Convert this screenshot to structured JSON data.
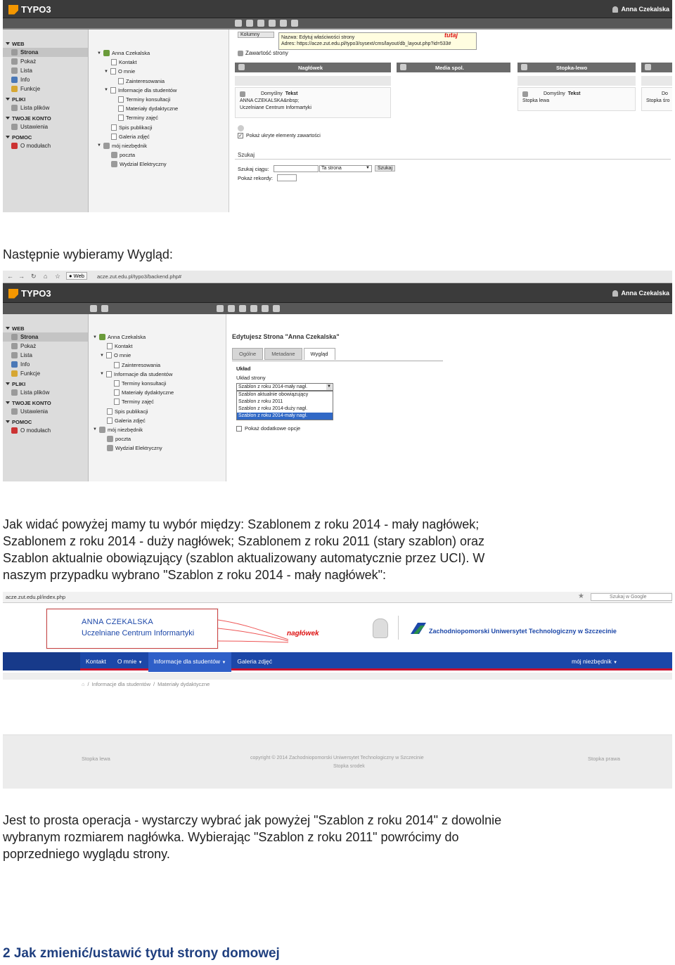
{
  "shot1": {
    "logo": "TYPO3",
    "user": "Anna Czekalska",
    "module_menu": [
      {
        "group": "WEB",
        "items": [
          "Strona",
          "Pokaż",
          "Lista",
          "Info",
          "Funkcje"
        ],
        "active": "Strona"
      },
      {
        "group": "PLIKI",
        "items": [
          "Lista plików"
        ]
      },
      {
        "group": "TWOJE KONTO",
        "items": [
          "Ustawienia"
        ]
      },
      {
        "group": "POMOC",
        "items": [
          "O modułach"
        ]
      }
    ],
    "tree": [
      "Anna Czekalska",
      "Kontakt",
      "O mnie",
      "Zainteresowania",
      "Informacje dla studentów",
      "Terminy konsultacji",
      "Materiały dydaktyczne",
      "Terminy zajęć",
      "Spis publikacji",
      "Galeria zdjęć",
      "mój niezbędnik",
      "poczta",
      "Wydział Elektryczny"
    ],
    "column_select": "Kolumny",
    "tooltip_line1": "Nazwa: Edytuj właściwości strony",
    "tooltip_line2": "Adres: https://acze.zut.edu.pl/typo3/sysext/cms/layout/db_layout.php?id=533#",
    "tooltip_note": "tutaj",
    "content_title": "Zawartość strony",
    "columns": [
      "Nagłówek",
      "Media spol.",
      "Stopka-lewo"
    ],
    "col1_type": "Domyślny",
    "col1_type_b": "Tekst",
    "col1_line1": "ANNA CZEKALSKA&nbsp;",
    "col1_line2": "Uczelniane Centrum Informartyki",
    "col3_type": "Domyślny",
    "col3_type_b": "Tekst",
    "col3_line1": "Stopka lewa",
    "col4_type": "Do",
    "col4_line1": "Stopka śro",
    "show_hidden": "Pokaż ukryte elementy zawartości",
    "search_title": "Szukaj",
    "search_label": "Szukaj ciągu:",
    "search_scope": "Ta strona",
    "search_button": "Szukaj",
    "records_label": "Pokaż rekordy:"
  },
  "heading1": "Następnie wybieramy Wygląd:",
  "shot2": {
    "browser_btn": "Web",
    "url": "acze.zut.edu.pl/typo3/backend.php#",
    "logo": "TYPO3",
    "user": "Anna Czekalska",
    "module_menu": [
      {
        "group": "WEB",
        "items": [
          "Strona",
          "Pokaż",
          "Lista",
          "Info",
          "Funkcje"
        ],
        "active": "Strona"
      },
      {
        "group": "PLIKI",
        "items": [
          "Lista plików"
        ]
      },
      {
        "group": "TWOJE KONTO",
        "items": [
          "Ustawienia"
        ]
      },
      {
        "group": "POMOC",
        "items": [
          "O modułach"
        ]
      }
    ],
    "tree": [
      "Anna Czekalska",
      "Kontakt",
      "O mnie",
      "Zainteresowania",
      "Informacje dla studentów",
      "Terminy konsultacji",
      "Materiały dydaktyczne",
      "Terminy zajęć",
      "Spis publikacji",
      "Galeria zdjęć",
      "mój niezbędnik",
      "poczta",
      "Wydział Elektryczny"
    ],
    "edit_title": "Edytujesz Strona \"Anna Czekalska\"",
    "tabs": [
      "Ogólne",
      "Metadane",
      "Wygląd"
    ],
    "section": "Układ",
    "field_label": "Układ strony",
    "select_value": "Szablon z roku 2014-mały nagł.",
    "options": [
      "Szablon aktualnie obowiązujący",
      "Szablon z roku 2011",
      "Szablon z roku 2014-duży nagł.",
      "Szablon z roku 2014-mały nagł."
    ],
    "extra_option": "Pokaż dodatkowe opcje"
  },
  "para1_l1": "Jak widać powyżej mamy tu wybór między: Szablonem z roku 2014 - mały nagłówek;",
  "para1_l2": "Szablonem z roku 2014 - duży nagłówek; Szablonem z roku 2011 (stary szablon) oraz",
  "para1_l3": "Szablon aktualnie obowiązujący (szablon aktualizowany automatycznie przez UCI). W",
  "para1_l4": "naszym przypadku wybrano \"Szablon z roku 2014 - mały nagłówek\":",
  "shot3": {
    "url": "acze.zut.edu.pl/index.php",
    "search_placeholder": "Szukaj w Google",
    "header_name": "ANNA CZEKALSKA",
    "header_unit": "Uczelniane Centrum Informartyki",
    "header_note": "nagłówek",
    "university": "Zachodniopomorski Uniwersytet Technologiczny w Szczecinie",
    "nav": [
      "Kontakt",
      "O mnie",
      "Informacje dla studentów",
      "Galeria zdjęć"
    ],
    "nav_right": "mój niezbędnik",
    "breadcrumb1": "Informacje dla studentów",
    "breadcrumb2": "Materiały dydaktyczne",
    "footer_left": "Stopka lewa",
    "footer_center": "copyright © 2014 Zachodniopomorski Uniwersytet Technologiczny w Szczecinie",
    "footer_center2": "Stopka srodek",
    "footer_right": "Stopka prawa"
  },
  "para2_l1": "Jest to prosta operacja - wystarczy wybrać jak powyżej \"Szablon z roku 2014\" z dowolnie",
  "para2_l2": "wybranym rozmiarem nagłówka. Wybierając \"Szablon z roku 2011\" powrócimy do",
  "para2_l3": "poprzedniego wyglądu strony.",
  "section_heading": "2 Jak zmienić/ustawić tytuł strony domowej",
  "colors": {
    "typo3_dark": "#3b3b3b",
    "typo3_orange": "#f49700",
    "zut_blue": "#1c47a8",
    "heading_blue": "#1f3f7f"
  }
}
